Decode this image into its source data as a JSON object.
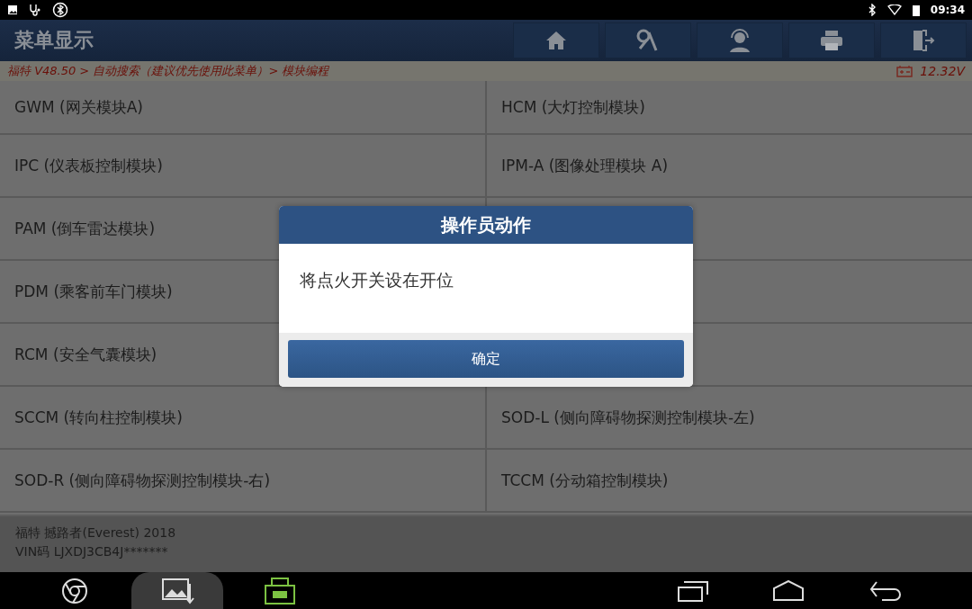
{
  "status_bar": {
    "time": "09:34"
  },
  "header": {
    "title": "菜单显示",
    "toolbar": [
      {
        "kind": "home"
      },
      {
        "kind": "tools"
      },
      {
        "kind": "support"
      },
      {
        "kind": "print"
      },
      {
        "kind": "exit"
      }
    ]
  },
  "breadcrumb": {
    "path": "福特 V48.50 > 自动搜索（建议优先使用此菜单）> 模块编程",
    "voltage": "12.32V"
  },
  "modules": [
    {
      "left": "GWM (网关模块A)",
      "right": "HCM (大灯控制模块)"
    },
    {
      "left": "IPC (仪表板控制模块)",
      "right": "IPM-A (图像处理模块 A)"
    },
    {
      "left": "PAM (倒车雷达模块)"
    },
    {
      "left": "PDM (乘客前车门模块)"
    },
    {
      "left": "RCM (安全气囊模块)"
    },
    {
      "left": "SCCM (转向柱控制模块)",
      "right": "SOD-L (侧向障碍物探测控制模块-左)"
    },
    {
      "left": "SOD-R (侧向障碍物探测控制模块-右)",
      "right": "TCCM (分动箱控制模块)"
    }
  ],
  "vehicle": {
    "model": "福特 撼路者(Everest) 2018",
    "vin": "VIN码 LJXDJ3CB4J*******"
  },
  "dialog": {
    "title": "操作员动作",
    "message": "将点火开关设在开位",
    "button": "确定"
  },
  "nav_bar": {
    "apps": [
      {
        "kind": "browser",
        "selected": false
      },
      {
        "kind": "screenshot",
        "selected": true
      },
      {
        "kind": "vci",
        "selected": false
      }
    ]
  }
}
